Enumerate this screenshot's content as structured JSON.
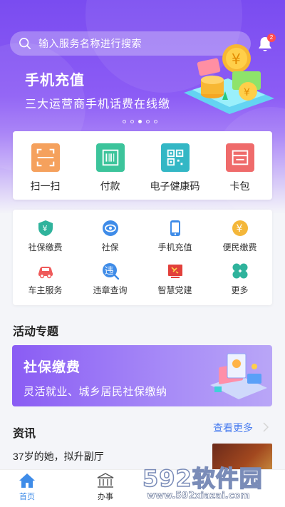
{
  "search": {
    "placeholder": "输入服务名称进行搜索"
  },
  "notifications": {
    "badge": "2"
  },
  "banner": {
    "title": "手机充值",
    "subtitle": "三大运营商手机话费在线缴",
    "page_count": 5,
    "active_page": 3
  },
  "quick_actions": [
    {
      "label": "扫一扫",
      "icon": "scan-icon",
      "color": "#f5a15d"
    },
    {
      "label": "付款",
      "icon": "barcode-icon",
      "color": "#3cc49b"
    },
    {
      "label": "电子健康码",
      "icon": "qrcode-icon",
      "color": "#33b7c5"
    },
    {
      "label": "卡包",
      "icon": "wallet-icon",
      "color": "#ef6b6b"
    }
  ],
  "services": [
    {
      "label": "社保缴费",
      "icon": "shield-yen-icon",
      "color": "#2fb39c"
    },
    {
      "label": "社保",
      "icon": "eye-badge-icon",
      "color": "#3f8ce8"
    },
    {
      "label": "手机充值",
      "icon": "phone-icon",
      "color": "#3f8ce8"
    },
    {
      "label": "便民缴费",
      "icon": "yen-circle-icon",
      "color": "#f4b73a"
    },
    {
      "label": "车主服务",
      "icon": "car-icon",
      "color": "#ef5a5a"
    },
    {
      "label": "违章查询",
      "icon": "violation-search-icon",
      "color": "#3f8ce8"
    },
    {
      "label": "智慧党建",
      "icon": "party-flag-icon",
      "color": "#e2403b"
    },
    {
      "label": "更多",
      "icon": "clover-more-icon",
      "color": "#2fb39c"
    }
  ],
  "activity": {
    "section_title": "活动专题",
    "promo_title": "社保缴费",
    "promo_subtitle": "灵活就业、城乡居民社保缴纳"
  },
  "news": {
    "section_title": "资讯",
    "more_label": "查看更多",
    "items": [
      {
        "title": "37岁的她，拟升副厅"
      }
    ]
  },
  "tabbar": {
    "tabs": [
      {
        "label": "首页",
        "active": true
      },
      {
        "label": "办事",
        "active": false
      }
    ]
  },
  "watermark": {
    "logo": "592软件园",
    "url": "www.592xiazai.com"
  },
  "colors": {
    "accent": "#7a4cf0",
    "link": "#4a7df0",
    "tab_active": "#3f8ce8"
  }
}
